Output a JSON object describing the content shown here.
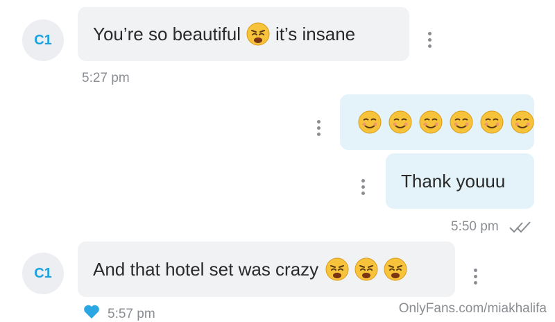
{
  "messages": [
    {
      "sender_avatar": "C1",
      "text_before": "You’re so beautiful",
      "text_after": "it’s insane",
      "time": "5:27 pm"
    },
    {
      "emojis": "☺☺☺☺☺☺"
    },
    {
      "text": "Thank youuu",
      "time": "5:50 pm"
    },
    {
      "sender_avatar": "C1",
      "text": "And that hotel set was crazy",
      "time": "5:57 pm"
    }
  ],
  "watermark": "OnlyFans.com/miakhalifa",
  "icons": {
    "more": "vertical-dots-icon",
    "read": "double-check-icon",
    "like": "heart-icon",
    "weary": "weary-face-emoji",
    "smiling": "smiling-face-emoji"
  },
  "colors": {
    "avatar_text": "#1aa3e0",
    "incoming_bubble": "#f1f2f4",
    "outgoing_bubble": "#e3f3f9",
    "heart": "#2aa7e3"
  }
}
